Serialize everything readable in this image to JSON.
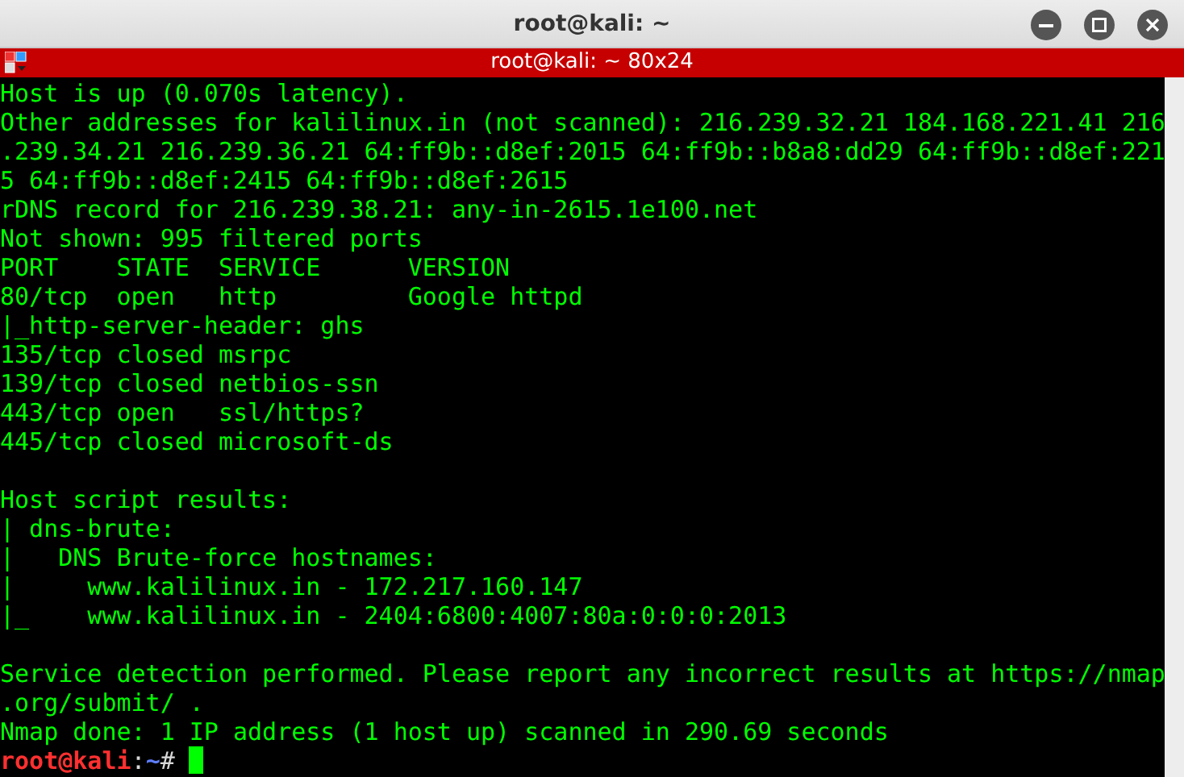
{
  "window": {
    "title": "root@kali: ~"
  },
  "terminal": {
    "title": "root@kali: ~ 80x24",
    "lines": [
      {
        "kind": "text",
        "text": "Host is up (0.070s latency)."
      },
      {
        "kind": "text",
        "text": "Other addresses for kalilinux.in (not scanned): 216.239.32.21 184.168.221.41 216"
      },
      {
        "kind": "text",
        "text": ".239.34.21 216.239.36.21 64:ff9b::d8ef:2015 64:ff9b::b8a8:dd29 64:ff9b::d8ef:221"
      },
      {
        "kind": "text",
        "text": "5 64:ff9b::d8ef:2415 64:ff9b::d8ef:2615"
      },
      {
        "kind": "text",
        "text": "rDNS record for 216.239.38.21: any-in-2615.1e100.net"
      },
      {
        "kind": "text",
        "text": "Not shown: 995 filtered ports"
      },
      {
        "kind": "text",
        "text": "PORT    STATE  SERVICE      VERSION"
      },
      {
        "kind": "text",
        "text": "80/tcp  open   http         Google httpd"
      },
      {
        "kind": "text",
        "text": "|_http-server-header: ghs"
      },
      {
        "kind": "text",
        "text": "135/tcp closed msrpc"
      },
      {
        "kind": "text",
        "text": "139/tcp closed netbios-ssn"
      },
      {
        "kind": "text",
        "text": "443/tcp open   ssl/https?"
      },
      {
        "kind": "text",
        "text": "445/tcp closed microsoft-ds"
      },
      {
        "kind": "blank"
      },
      {
        "kind": "text",
        "text": "Host script results:"
      },
      {
        "kind": "text",
        "text": "| dns-brute:"
      },
      {
        "kind": "text",
        "text": "|   DNS Brute-force hostnames:"
      },
      {
        "kind": "text",
        "text": "|     www.kalilinux.in - 172.217.160.147"
      },
      {
        "kind": "text",
        "text": "|_    www.kalilinux.in - 2404:6800:4007:80a:0:0:0:2013"
      },
      {
        "kind": "blank"
      },
      {
        "kind": "text",
        "text": "Service detection performed. Please report any incorrect results at https://nmap"
      },
      {
        "kind": "text",
        "text": ".org/submit/ ."
      },
      {
        "kind": "text",
        "text": "Nmap done: 1 IP address (1 host up) scanned in 290.69 seconds"
      }
    ],
    "prompt": {
      "user_host": "root@kali",
      "separator": ":",
      "path": "~",
      "symbol": "#",
      "cursor": true
    }
  }
}
